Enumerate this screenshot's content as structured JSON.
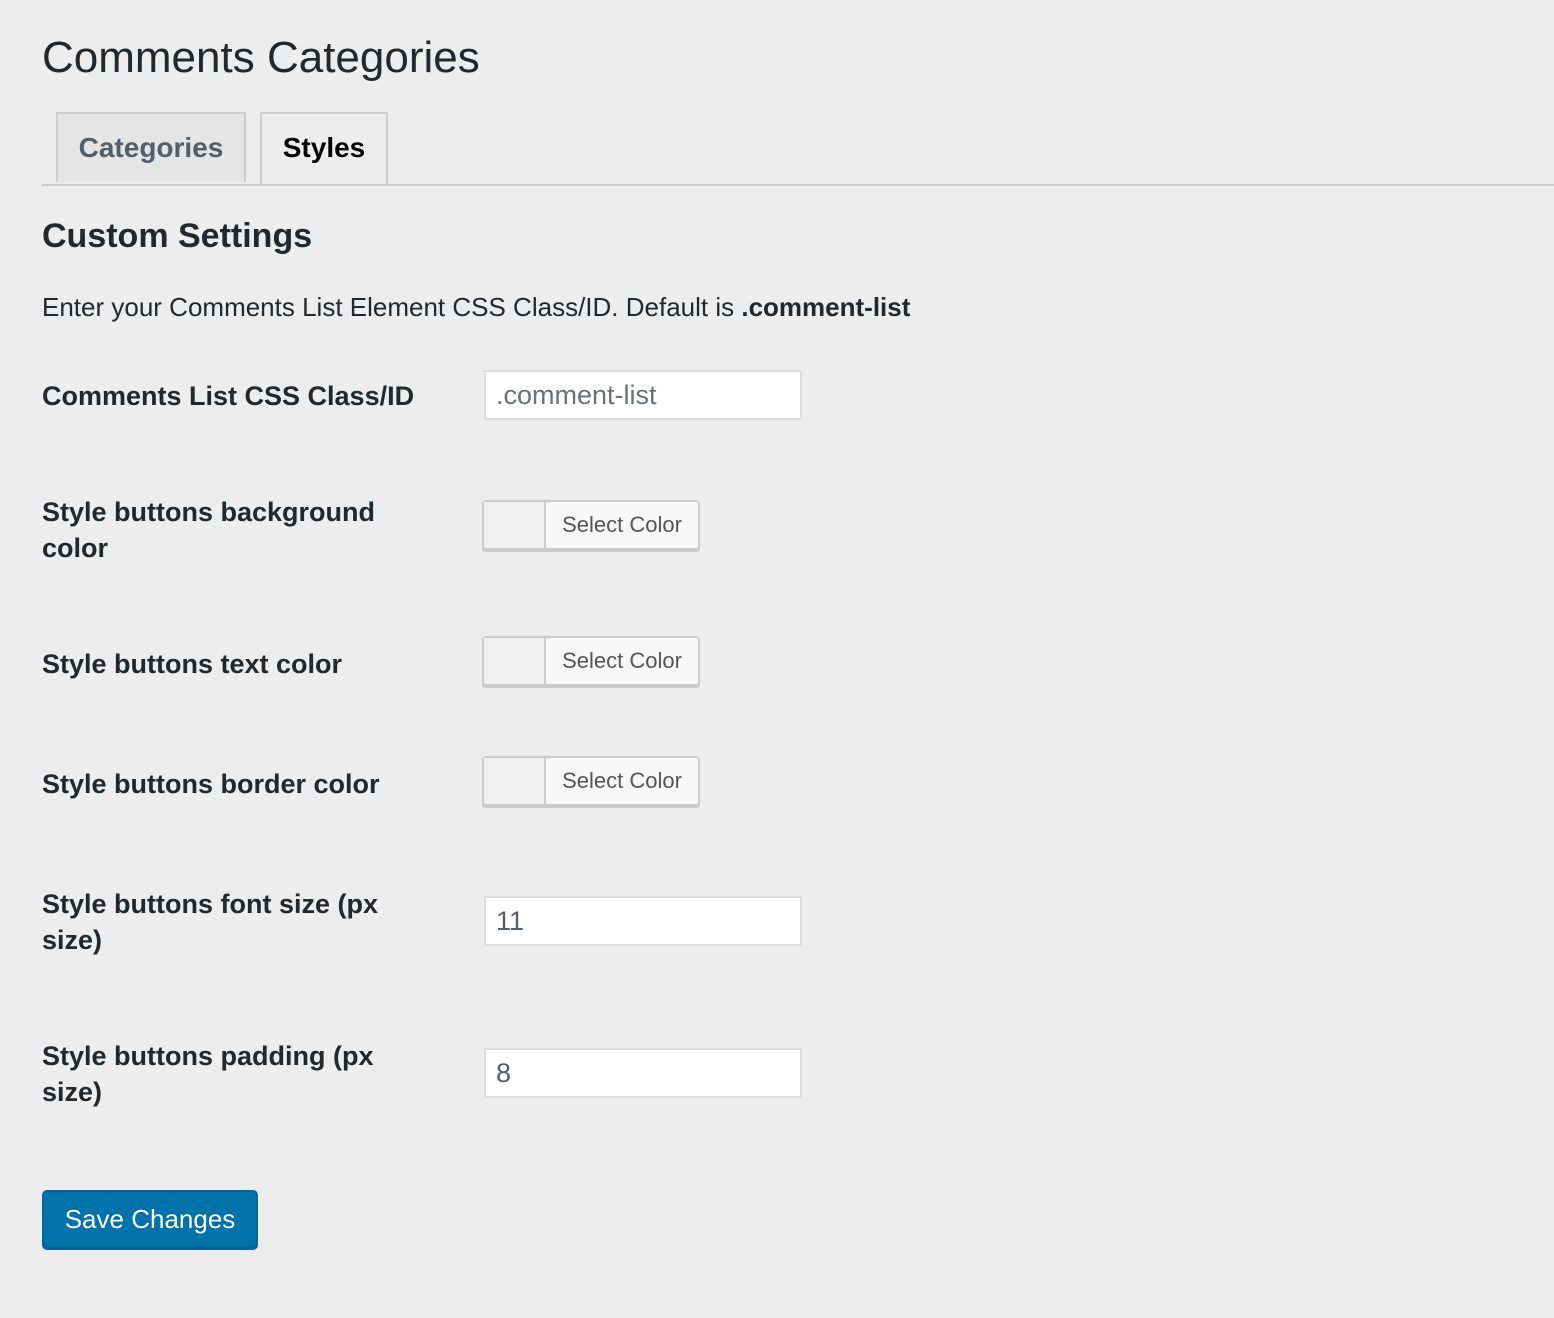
{
  "page": {
    "title": "Comments Categories"
  },
  "tabs": [
    {
      "label": "Categories",
      "active": false
    },
    {
      "label": "Styles",
      "active": true
    }
  ],
  "section": {
    "title": "Custom Settings",
    "description_prefix": "Enter your Comments List Element CSS Class/ID. Default is ",
    "description_default": ".comment-list"
  },
  "fields": {
    "css_class": {
      "label": "Comments List CSS Class/ID",
      "value": "",
      "placeholder": ".comment-list"
    },
    "bg_color": {
      "label": "Style buttons background color",
      "button_label": "Select Color"
    },
    "text_color": {
      "label": "Style buttons text color",
      "button_label": "Select Color"
    },
    "border_color": {
      "label": "Style buttons border color",
      "button_label": "Select Color"
    },
    "font_size": {
      "label": "Style buttons font size (px size)",
      "value": "11"
    },
    "padding": {
      "label": "Style buttons padding (px size)",
      "value": "8"
    }
  },
  "actions": {
    "save_label": "Save Changes"
  },
  "colors": {
    "background": "#ededed",
    "primary_button": "#0073aa",
    "text": "#23282d"
  }
}
